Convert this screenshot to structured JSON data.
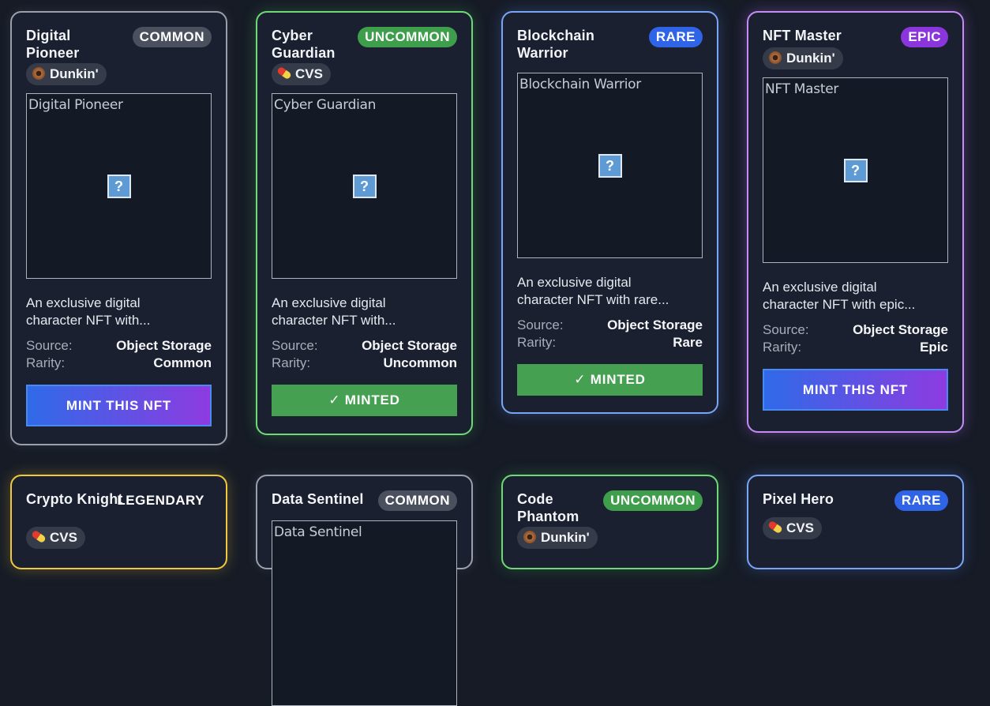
{
  "cards": [
    {
      "title": "Digital Pioneer",
      "rarity_badge": "COMMON",
      "brand": "Dunkin'",
      "alt": "Digital Pioneer",
      "desc1": "An exclusive digital",
      "desc2": "character NFT with...",
      "source_label": "Source:",
      "source": "Object Storage",
      "rarity_label": "Rarity:",
      "rarity": "Common",
      "action": "MINT THIS NFT"
    },
    {
      "title": "Cyber Guardian",
      "rarity_badge": "UNCOMMON",
      "brand": "CVS",
      "alt": "Cyber Guardian",
      "desc1": "An exclusive digital",
      "desc2": "character NFT with...",
      "source_label": "Source:",
      "source": "Object Storage",
      "rarity_label": "Rarity:",
      "rarity": "Uncommon",
      "action": "✓ MINTED"
    },
    {
      "title": "Blockchain Warrior",
      "rarity_badge": "RARE",
      "alt": "Blockchain Warrior",
      "desc1": "An exclusive digital",
      "desc2": "character NFT with rare...",
      "source_label": "Source:",
      "source": "Object Storage",
      "rarity_label": "Rarity:",
      "rarity": "Rare",
      "action": "✓ MINTED"
    },
    {
      "title": "NFT Master",
      "rarity_badge": "EPIC",
      "brand": "Dunkin'",
      "alt": "NFT Master",
      "desc1": "An exclusive digital",
      "desc2": "character NFT with epic...",
      "source_label": "Source:",
      "source": "Object Storage",
      "rarity_label": "Rarity:",
      "rarity": "Epic",
      "action": "MINT THIS NFT"
    },
    {
      "title": "Crypto Knight",
      "rarity_badge": "LEGENDARY",
      "brand": "CVS"
    },
    {
      "title": "Data Sentinel",
      "rarity_badge": "COMMON",
      "alt": "Data Sentinel"
    },
    {
      "title": "Code Phantom",
      "rarity_badge": "UNCOMMON",
      "brand": "Dunkin'"
    },
    {
      "title": "Pixel Hero",
      "rarity_badge": "RARE",
      "brand": "CVS"
    }
  ],
  "icons": {
    "broken_image": "?"
  }
}
